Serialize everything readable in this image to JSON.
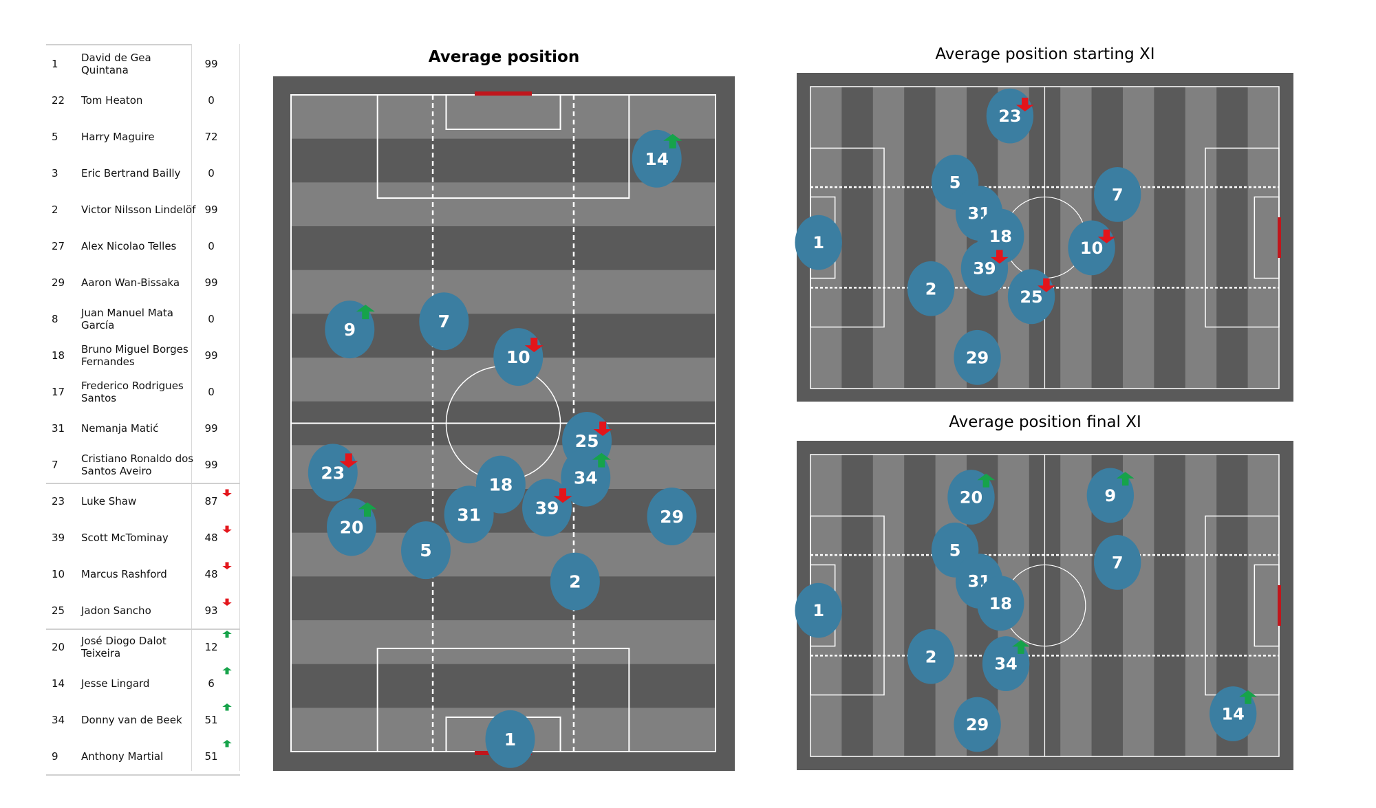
{
  "table": {
    "groups": [
      "starting_unchanged",
      "substituted_off",
      "substituted_on"
    ],
    "rows": [
      {
        "number": "1",
        "name": "David de Gea\nQuintana",
        "value": "99",
        "arrow": "none"
      },
      {
        "number": "22",
        "name": "Tom Heaton",
        "value": "0",
        "arrow": "none"
      },
      {
        "number": "5",
        "name": "Harry  Maguire",
        "value": "72",
        "arrow": "none"
      },
      {
        "number": "3",
        "name": "Eric Bertrand  Bailly",
        "value": "0",
        "arrow": "none"
      },
      {
        "number": "2",
        "name": "Victor Nilsson Lindelöf",
        "value": "99",
        "arrow": "none"
      },
      {
        "number": "27",
        "name": "Alex Nicolao Telles",
        "value": "0",
        "arrow": "none"
      },
      {
        "number": "29",
        "name": "Aaron Wan-Bissaka",
        "value": "99",
        "arrow": "none"
      },
      {
        "number": "8",
        "name": "Juan Manuel Mata\nGarcía",
        "value": "0",
        "arrow": "none"
      },
      {
        "number": "18",
        "name": "Bruno Miguel Borges\nFernandes",
        "value": "99",
        "arrow": "none"
      },
      {
        "number": "17",
        "name": "Frederico Rodrigues\nSantos",
        "value": "0",
        "arrow": "none"
      },
      {
        "number": "31",
        "name": "Nemanja Matić",
        "value": "99",
        "arrow": "none"
      },
      {
        "number": "7",
        "name": "Cristiano Ronaldo dos\nSantos Aveiro",
        "value": "99",
        "arrow": "none"
      },
      {
        "number": "23",
        "name": "Luke Shaw",
        "value": "87",
        "arrow": "down"
      },
      {
        "number": "39",
        "name": "Scott McTominay",
        "value": "48",
        "arrow": "down"
      },
      {
        "number": "10",
        "name": "Marcus Rashford",
        "value": "48",
        "arrow": "down"
      },
      {
        "number": "25",
        "name": "Jadon Sancho",
        "value": "93",
        "arrow": "down"
      },
      {
        "number": "20",
        "name": "José Diogo Dalot\nTeixeira",
        "value": "12",
        "arrow": "up"
      },
      {
        "number": "14",
        "name": "Jesse Lingard",
        "value": "6",
        "arrow": "up"
      },
      {
        "number": "34",
        "name": "Donny van de Beek",
        "value": "51",
        "arrow": "up"
      },
      {
        "number": "9",
        "name": "Anthony Martial",
        "value": "51",
        "arrow": "up"
      }
    ]
  },
  "colors": {
    "pitch_dark": "#5a5a5a",
    "pitch_light": "#808080",
    "line": "#ffffff",
    "goal": "#c0161c",
    "player": "#3b7ea1",
    "arrow_down": "#e3151b",
    "arrow_up": "#16a34a"
  },
  "chart_data": [
    {
      "type": "scatter",
      "title": "Average position",
      "orientation": "vertical",
      "pitch": {
        "length": 105,
        "width": 68
      },
      "points": [
        {
          "label": "14",
          "x": 94.8,
          "y": 58.6,
          "arrow": "up"
        },
        {
          "label": "9",
          "x": 67.5,
          "y": 9.4,
          "arrow": "up"
        },
        {
          "label": "7",
          "x": 68.8,
          "y": 24.5,
          "arrow": "none"
        },
        {
          "label": "10",
          "x": 63.1,
          "y": 36.4,
          "arrow": "down"
        },
        {
          "label": "25",
          "x": 49.7,
          "y": 47.4,
          "arrow": "down"
        },
        {
          "label": "23",
          "x": 44.6,
          "y": 6.7,
          "arrow": "down"
        },
        {
          "label": "34",
          "x": 43.8,
          "y": 47.2,
          "arrow": "up"
        },
        {
          "label": "18",
          "x": 42.7,
          "y": 33.6,
          "arrow": "none"
        },
        {
          "label": "39",
          "x": 39.0,
          "y": 41.0,
          "arrow": "down"
        },
        {
          "label": "31",
          "x": 37.9,
          "y": 28.5,
          "arrow": "none"
        },
        {
          "label": "29",
          "x": 37.6,
          "y": 61.0,
          "arrow": "none"
        },
        {
          "label": "20",
          "x": 35.9,
          "y": 9.7,
          "arrow": "up"
        },
        {
          "label": "5",
          "x": 32.2,
          "y": 21.6,
          "arrow": "none"
        },
        {
          "label": "2",
          "x": 27.2,
          "y": 45.5,
          "arrow": "none"
        },
        {
          "label": "1",
          "x": 2.0,
          "y": 35.1,
          "arrow": "none"
        }
      ]
    },
    {
      "type": "scatter",
      "title": "Average position starting XI",
      "orientation": "horizontal",
      "pitch": {
        "length": 105,
        "width": 68
      },
      "points": [
        {
          "label": "23",
          "x": 44.7,
          "y": 6.6,
          "arrow": "down"
        },
        {
          "label": "5",
          "x": 32.4,
          "y": 21.5,
          "arrow": "none"
        },
        {
          "label": "7",
          "x": 68.8,
          "y": 24.3,
          "arrow": "none"
        },
        {
          "label": "31",
          "x": 37.8,
          "y": 28.5,
          "arrow": "none"
        },
        {
          "label": "18",
          "x": 42.6,
          "y": 33.7,
          "arrow": "none"
        },
        {
          "label": "1",
          "x": 1.8,
          "y": 35.1,
          "arrow": "none"
        },
        {
          "label": "10",
          "x": 63.0,
          "y": 36.3,
          "arrow": "down"
        },
        {
          "label": "39",
          "x": 39.0,
          "y": 40.9,
          "arrow": "down"
        },
        {
          "label": "2",
          "x": 27.0,
          "y": 45.5,
          "arrow": "none"
        },
        {
          "label": "25",
          "x": 49.5,
          "y": 47.3,
          "arrow": "down"
        },
        {
          "label": "29",
          "x": 37.4,
          "y": 61.0,
          "arrow": "none"
        }
      ]
    },
    {
      "type": "scatter",
      "title": "Average position final XI",
      "orientation": "horizontal",
      "pitch": {
        "length": 105,
        "width": 68
      },
      "points": [
        {
          "label": "20",
          "x": 36.0,
          "y": 9.6,
          "arrow": "up"
        },
        {
          "label": "9",
          "x": 67.2,
          "y": 9.2,
          "arrow": "up"
        },
        {
          "label": "5",
          "x": 32.4,
          "y": 21.5,
          "arrow": "none"
        },
        {
          "label": "7",
          "x": 68.8,
          "y": 24.3,
          "arrow": "none"
        },
        {
          "label": "31",
          "x": 37.8,
          "y": 28.5,
          "arrow": "none"
        },
        {
          "label": "18",
          "x": 42.6,
          "y": 33.5,
          "arrow": "none"
        },
        {
          "label": "1",
          "x": 1.8,
          "y": 35.1,
          "arrow": "none"
        },
        {
          "label": "2",
          "x": 27.0,
          "y": 45.5,
          "arrow": "none"
        },
        {
          "label": "34",
          "x": 43.8,
          "y": 47.1,
          "arrow": "up"
        },
        {
          "label": "29",
          "x": 37.4,
          "y": 60.8,
          "arrow": "none"
        },
        {
          "label": "14",
          "x": 94.7,
          "y": 58.4,
          "arrow": "up"
        }
      ]
    }
  ]
}
